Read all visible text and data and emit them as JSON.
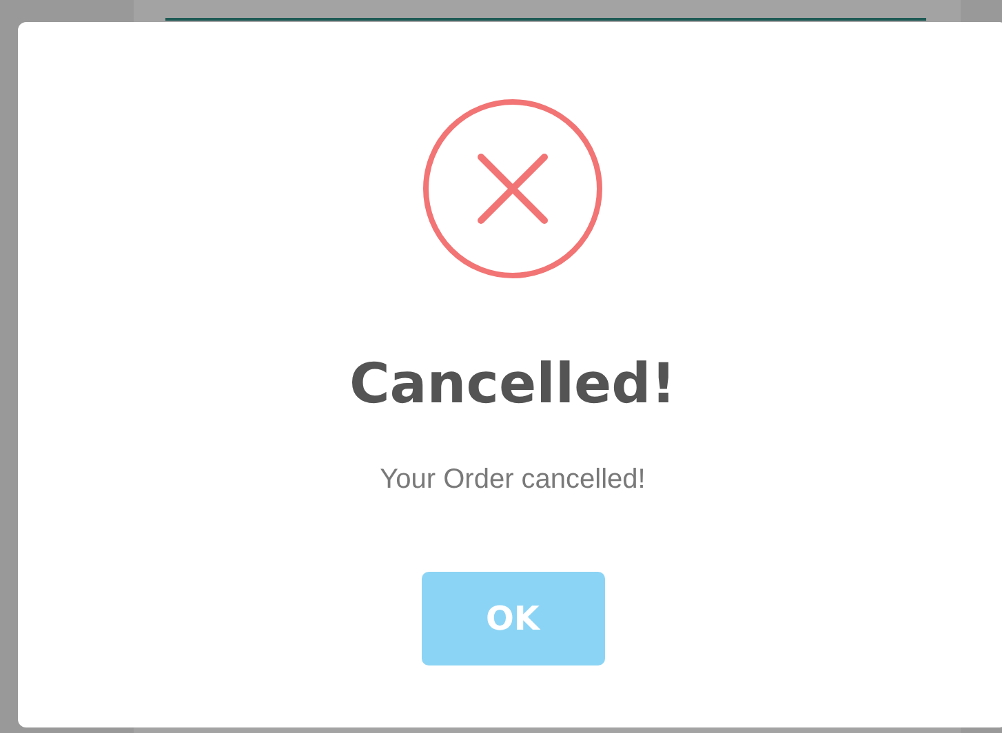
{
  "dialog": {
    "title": "Cancelled!",
    "message": "Your Order cancelled!",
    "button": "OK"
  }
}
